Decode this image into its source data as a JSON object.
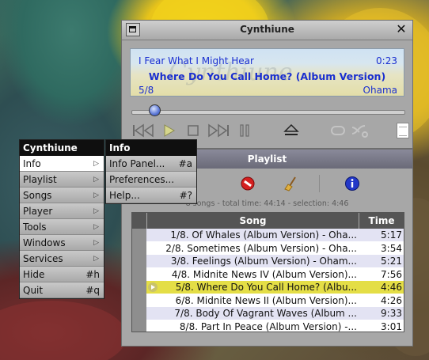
{
  "player": {
    "title": "Cynthiune",
    "watermark": "Cynthiune",
    "artist": "I Fear What I Might Hear",
    "elapsed": "0:23",
    "song": "Where Do You Call Home? (Album Version)",
    "track": "5/8",
    "album": "Ohama",
    "seek_fraction": 0.08,
    "controls": [
      "previous-icon",
      "play-icon",
      "stop-icon",
      "next-icon",
      "pause-icon",
      "eject-icon",
      "repeat-icon",
      "shuffle-icon",
      "playlist-toggle-icon"
    ]
  },
  "playlist": {
    "title": "Playlist",
    "stats": "8 songs - total time: 44:14 - selection: 4:46",
    "columns": {
      "song": "Song",
      "time": "Time"
    },
    "tools": [
      "remove-icon",
      "clear-icon",
      "info-icon"
    ],
    "rows": [
      {
        "song": "1/8. Of Whales (Album Version) - Oha...",
        "time": "5:17"
      },
      {
        "song": "2/8. Sometimes (Album Version) - Oha...",
        "time": "3:54"
      },
      {
        "song": "3/8. Feelings (Album Version) - Oham...",
        "time": "5:21"
      },
      {
        "song": "4/8. Midnite News IV (Album Version)...",
        "time": "7:56"
      },
      {
        "song": "5/8. Where Do You Call Home? (Albu...",
        "time": "4:46"
      },
      {
        "song": "6/8. Midnite News II (Album Version)...",
        "time": "4:26"
      },
      {
        "song": "7/8. Body Of Vagrant Waves (Album ...",
        "time": "9:33"
      },
      {
        "song": "8/8. Part In Peace (Album Version) -...",
        "time": "3:01"
      }
    ],
    "current_index": 4
  },
  "menu": {
    "title": "Cynthiune",
    "items": [
      {
        "label": "Info",
        "submenu": true
      },
      {
        "label": "Playlist",
        "submenu": true
      },
      {
        "label": "Songs",
        "submenu": true
      },
      {
        "label": "Player",
        "submenu": true
      },
      {
        "label": "Tools",
        "submenu": true
      },
      {
        "label": "Windows",
        "submenu": true
      },
      {
        "label": "Services",
        "submenu": true
      },
      {
        "label": "Hide",
        "key": "#h"
      },
      {
        "label": "Quit",
        "key": "#q"
      }
    ]
  },
  "submenu": {
    "title": "Info",
    "items": [
      {
        "label": "Info Panel...",
        "key": "#a"
      },
      {
        "label": "Preferences...",
        "key": ""
      },
      {
        "label": "Help...",
        "key": "#?"
      }
    ]
  },
  "colors": {
    "lcd_text": "#1a2fd0",
    "current_row": "#e4de46",
    "alt_row": "#e3e3f3"
  }
}
